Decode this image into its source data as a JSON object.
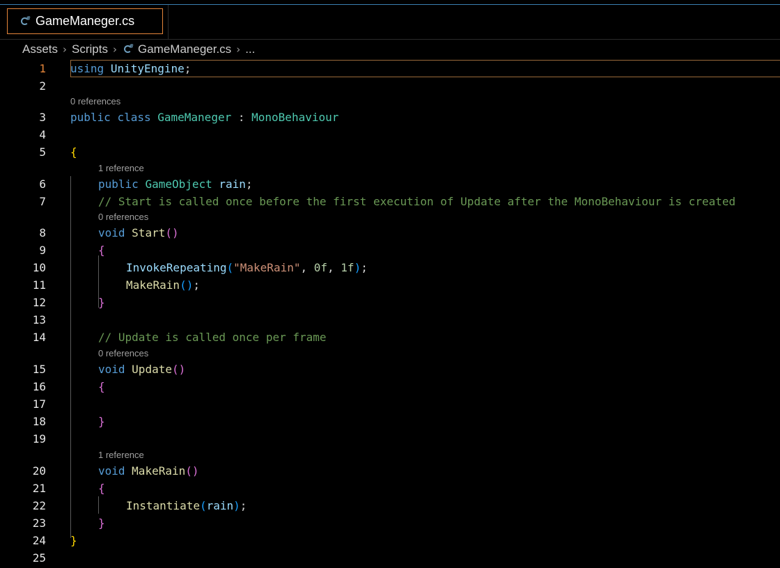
{
  "tab": {
    "filename": "GameManeger.cs",
    "icon": "csharp-file-icon"
  },
  "breadcrumb": [
    "Assets",
    "Scripts",
    "GameManeger.cs",
    "..."
  ],
  "lenses": {
    "class_refs": "0 references",
    "rain_refs": "1 reference",
    "start_refs": "0 references",
    "update_refs": "0 references",
    "makerain_refs": "1 reference"
  },
  "line_numbers": [
    "1",
    "2",
    "3",
    "4",
    "5",
    "6",
    "7",
    "8",
    "9",
    "10",
    "11",
    "12",
    "13",
    "14",
    "15",
    "16",
    "17",
    "18",
    "19",
    "20",
    "21",
    "22",
    "23",
    "24",
    "25"
  ],
  "code": {
    "l1_using": "using",
    "l1_ns": "UnityEngine",
    "l1_semi": ";",
    "l3_public": "public",
    "l3_class": "class",
    "l3_name": "GameManeger",
    "l3_colon": ":",
    "l3_base": "MonoBehaviour",
    "l5_brace": "{",
    "l6_public": "public",
    "l6_type": "GameObject",
    "l6_var": "rain",
    "l6_semi": ";",
    "l7_comment": "// Start is called once before the first execution of Update after the MonoBehaviour is created",
    "l8_void": "void",
    "l8_fn": "Start",
    "l8_parens": "()",
    "l9_brace": "{",
    "l10_fn": "InvokeRepeating",
    "l10_open": "(",
    "l10_str": "\"MakeRain\"",
    "l10_c1": ",",
    "l10_n1": "0f",
    "l10_c2": ",",
    "l10_n2": "1f",
    "l10_close": ")",
    "l10_semi": ";",
    "l11_fn": "MakeRain",
    "l11_parens": "()",
    "l11_semi": ";",
    "l12_brace": "}",
    "l14_comment": "// Update is called once per frame",
    "l15_void": "void",
    "l15_fn": "Update",
    "l15_parens": "()",
    "l16_brace": "{",
    "l18_brace": "}",
    "l20_void": "void",
    "l20_fn": "MakeRain",
    "l20_parens": "()",
    "l21_brace": "{",
    "l22_fn": "Instantiate",
    "l22_open": "(",
    "l22_arg": "rain",
    "l22_close": ")",
    "l22_semi": ";",
    "l23_brace": "}",
    "l24_brace": "}"
  },
  "colors": {
    "active_tab_border": "#e6863a",
    "keyword": "#569cd6",
    "type": "#4ec9b0",
    "function": "#dcdcaa",
    "string": "#ce9178",
    "comment": "#6a9955"
  }
}
